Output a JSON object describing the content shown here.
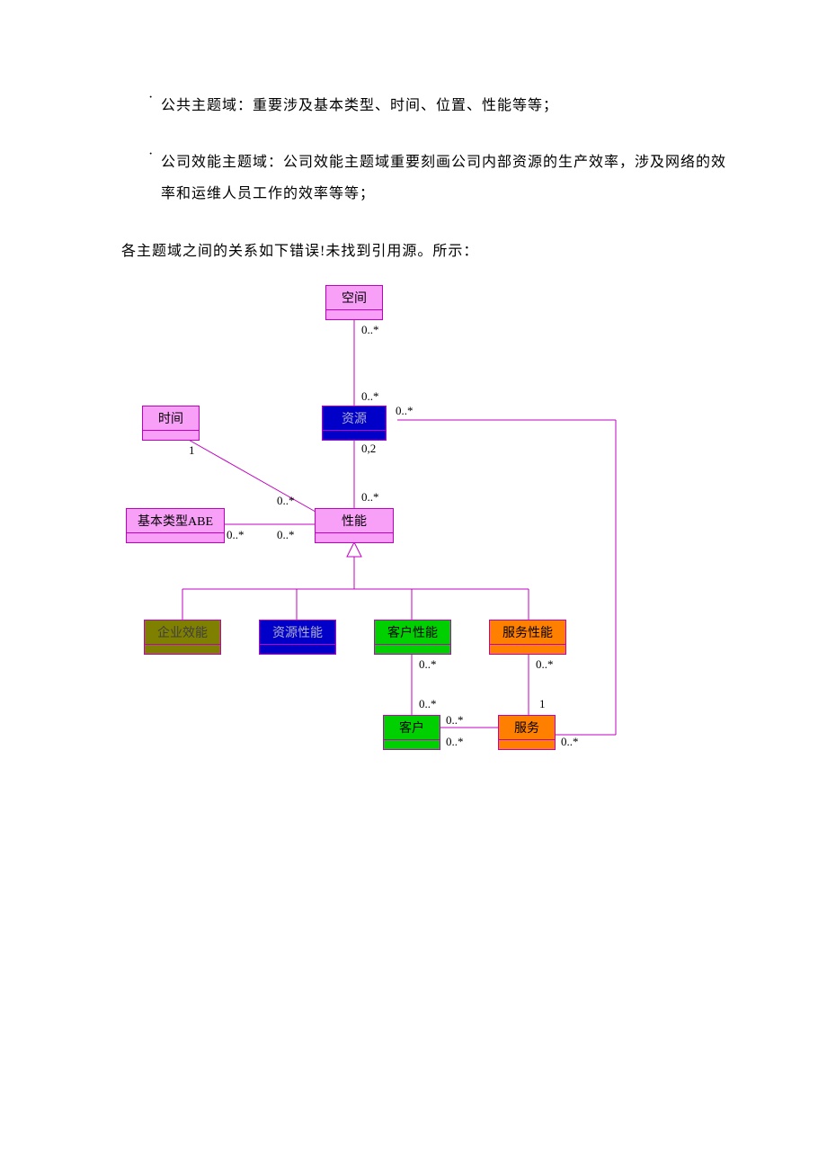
{
  "bullets": [
    {
      "dot": "·",
      "text": "公共主题域：重要涉及基本类型、时间、位置、性能等等；"
    },
    {
      "dot": "·",
      "text": "公司效能主题域：公司效能主题域重要刻画公司内部资源的生产效率，涉及网络的效率和运维人员工作的效率等等；"
    }
  ],
  "para": "各主题域之间的关系如下错误!未找到引用源。所示：",
  "nodes": {
    "space": {
      "label": "空间"
    },
    "time": {
      "label": "时间"
    },
    "resource": {
      "label": "资源"
    },
    "basic": {
      "label": "基本类型ABE"
    },
    "perf": {
      "label": "性能"
    },
    "ent_eff": {
      "label": "企业效能"
    },
    "res_perf": {
      "label": "资源性能"
    },
    "cust_perf": {
      "label": "客户性能"
    },
    "serv_perf": {
      "label": "服务性能"
    },
    "customer": {
      "label": "客户"
    },
    "service": {
      "label": "服务"
    }
  },
  "mult": {
    "m1": "0..*",
    "m2": "0..*",
    "m3": "0..*",
    "m4": "1",
    "m5": "0,2",
    "m6": "0..*",
    "m7": "0..*",
    "m8": "0..*",
    "m9": "0..*",
    "m10": "0..*",
    "m11": "0..*",
    "m12": "0..*",
    "m13": "1",
    "m14": "0..*",
    "m15": "0..*",
    "m16": "0..*"
  },
  "chart_data": {
    "type": "uml-class-diagram",
    "colors": {
      "pink": "#f8a0f8",
      "blue": "#0000c8",
      "olive": "#808000",
      "green": "#00d000",
      "orange": "#ff8000",
      "line": "#c000c0"
    },
    "classes": [
      {
        "id": "space",
        "label": "空间",
        "color": "pink"
      },
      {
        "id": "time",
        "label": "时间",
        "color": "pink"
      },
      {
        "id": "resource",
        "label": "资源",
        "color": "blue"
      },
      {
        "id": "basic",
        "label": "基本类型ABE",
        "color": "pink"
      },
      {
        "id": "perf",
        "label": "性能",
        "color": "pink"
      },
      {
        "id": "ent_eff",
        "label": "企业效能",
        "color": "olive"
      },
      {
        "id": "res_perf",
        "label": "资源性能",
        "color": "blue"
      },
      {
        "id": "cust_perf",
        "label": "客户性能",
        "color": "green"
      },
      {
        "id": "serv_perf",
        "label": "服务性能",
        "color": "orange"
      },
      {
        "id": "customer",
        "label": "客户",
        "color": "green"
      },
      {
        "id": "service",
        "label": "服务",
        "color": "orange"
      }
    ],
    "associations": [
      {
        "from": "space",
        "to": "resource",
        "mult_from": "0..*",
        "mult_to": "0..*"
      },
      {
        "from": "resource",
        "to": "perf",
        "mult_from": "0,2",
        "mult_to": "0..*"
      },
      {
        "from": "resource",
        "to": "service",
        "mult_from": "0..*",
        "mult_to": "0..*"
      },
      {
        "from": "time",
        "to": "perf",
        "mult_from": "1",
        "mult_to": "0..*"
      },
      {
        "from": "basic",
        "to": "perf",
        "mult_from": "0..*",
        "mult_to": "0..*"
      },
      {
        "from": "cust_perf",
        "to": "customer",
        "mult_from": "0..*",
        "mult_to": "0..*"
      },
      {
        "from": "serv_perf",
        "to": "service",
        "mult_from": "0..*",
        "mult_to": "1"
      },
      {
        "from": "customer",
        "to": "service",
        "mult_from": "0..*",
        "mult_to": "0..*"
      }
    ],
    "generalizations": [
      {
        "parent": "perf",
        "child": "ent_eff"
      },
      {
        "parent": "perf",
        "child": "res_perf"
      },
      {
        "parent": "perf",
        "child": "cust_perf"
      },
      {
        "parent": "perf",
        "child": "serv_perf"
      }
    ]
  }
}
